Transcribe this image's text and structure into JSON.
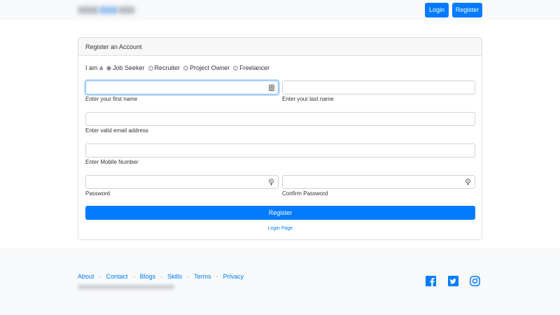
{
  "navbar": {
    "login_label": "Login",
    "register_label": "Register"
  },
  "card": {
    "title": "Register an Account",
    "role_prefix": "I am a",
    "roles": [
      {
        "label": "Job Seeker",
        "checked": true
      },
      {
        "label": "Recruiter",
        "checked": false
      },
      {
        "label": "Project Owner",
        "checked": false
      },
      {
        "label": "Freelancer",
        "checked": false
      }
    ],
    "first_name": {
      "value": "",
      "hint": "Enter your first name"
    },
    "last_name": {
      "value": "",
      "hint": "Enter your last name"
    },
    "email": {
      "value": "",
      "hint": "Enter valid email address"
    },
    "mobile": {
      "value": "",
      "hint": "Enter Mobile Number"
    },
    "password": {
      "value": "",
      "hint": "Password"
    },
    "confirm_password": {
      "value": "",
      "hint": "Confirm Password"
    },
    "submit_label": "Register",
    "login_link": "Login Page"
  },
  "footer": {
    "links": [
      "About",
      "Contact",
      "Blogs",
      "Skills",
      "Terms",
      "Privacy"
    ],
    "separator": "·",
    "social_icons": [
      "facebook-icon",
      "twitter-icon",
      "instagram-icon"
    ]
  },
  "colors": {
    "primary": "#007bff",
    "light_bg": "#f8f9fa",
    "card_header_bg": "#f7f7f7",
    "focus_border": "#80bdff"
  }
}
